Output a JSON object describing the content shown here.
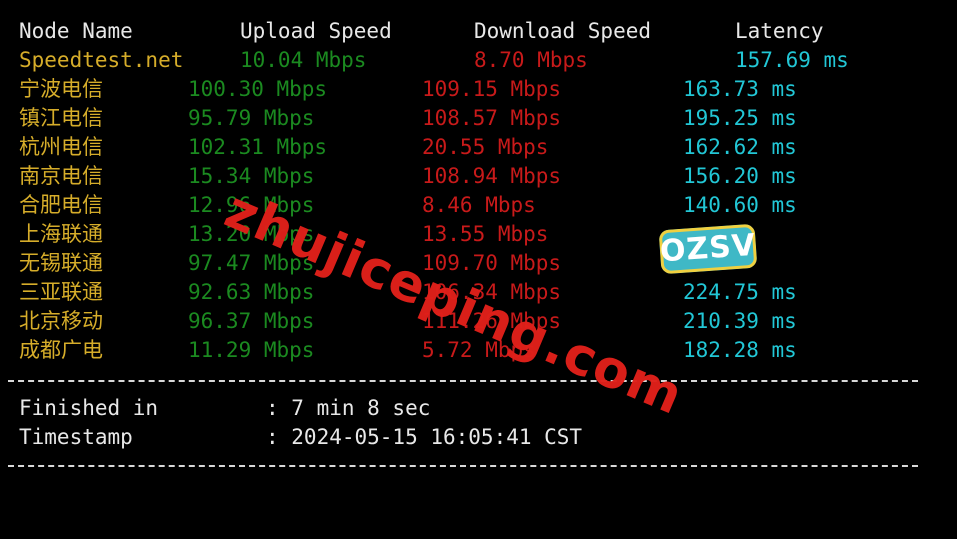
{
  "header": {
    "node": "Node Name",
    "upload": "Upload Speed",
    "download": "Download Speed",
    "latency": "Latency"
  },
  "rows": [
    {
      "node": "Speedtest.net",
      "upload": "10.04 Mbps",
      "download": "8.70 Mbps",
      "latency": "157.69 ms"
    },
    {
      "node": "宁波电信",
      "upload": "100.30 Mbps",
      "download": "109.15 Mbps",
      "latency": "163.73 ms"
    },
    {
      "node": "镇江电信",
      "upload": "95.79 Mbps",
      "download": "108.57 Mbps",
      "latency": "195.25 ms"
    },
    {
      "node": "杭州电信",
      "upload": "102.31 Mbps",
      "download": "20.55 Mbps",
      "latency": "162.62 ms"
    },
    {
      "node": "南京电信",
      "upload": "15.34 Mbps",
      "download": "108.94 Mbps",
      "latency": "156.20 ms"
    },
    {
      "node": "合肥电信",
      "upload": "12.96 Mbps",
      "download": "8.46 Mbps",
      "latency": "140.60 ms"
    },
    {
      "node": "上海联通",
      "upload": "13.20 Mbps",
      "download": "13.55 Mbps",
      "latency": ""
    },
    {
      "node": "无锡联通",
      "upload": "97.47 Mbps",
      "download": "109.70 Mbps",
      "latency": ""
    },
    {
      "node": "三亚联通",
      "upload": "92.63 Mbps",
      "download": "106.34 Mbps",
      "latency": "224.75 ms"
    },
    {
      "node": "北京移动",
      "upload": "96.37 Mbps",
      "download": "111.26 Mbps",
      "latency": "210.39 ms"
    },
    {
      "node": "成都广电",
      "upload": "11.29 Mbps",
      "download": "5.72 Mbps",
      "latency": "182.28 ms"
    }
  ],
  "summary": {
    "finished_label": "Finished in",
    "finished_value": ": 7 min 8 sec",
    "timestamp_label": "Timestamp",
    "timestamp_value": ": 2024-05-15 16:05:41 CST"
  },
  "overlay": {
    "watermark": "zhujiceping.com",
    "badge": "OZSV"
  },
  "colors": {
    "background": "#000000",
    "node": "#d6ad2a",
    "upload": "#1b8a20",
    "download": "#c81a1a",
    "latency": "#22c7d6",
    "text": "#e8e8e8"
  }
}
